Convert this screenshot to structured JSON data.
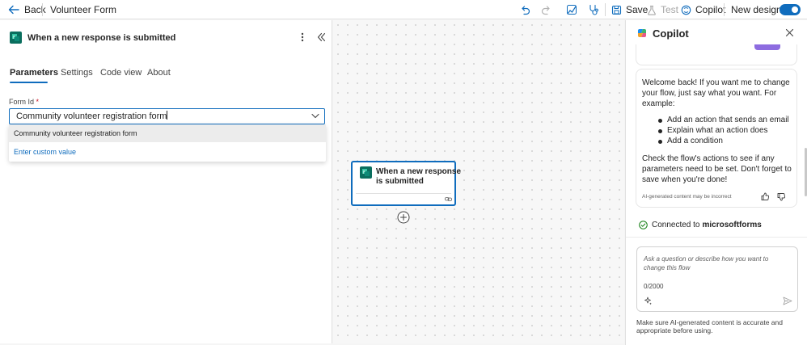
{
  "topbar": {
    "back_label": "Back",
    "flow_name": "Volunteer Form",
    "save_label": "Save",
    "test_label": "Test",
    "copilot_label": "Copilot",
    "new_designer_label": "New designer",
    "new_designer_on": true
  },
  "left_panel": {
    "title": "When a new response is submitted",
    "tabs": [
      {
        "label": "Parameters",
        "active": true
      },
      {
        "label": "Settings",
        "active": false
      },
      {
        "label": "Code view",
        "active": false
      },
      {
        "label": "About",
        "active": false
      }
    ],
    "form_id": {
      "label": "Form Id",
      "required_mark": "*",
      "value": "Community volunteer registration form",
      "options": [
        "Community volunteer registration form"
      ],
      "custom_value_label": "Enter custom value"
    }
  },
  "canvas": {
    "trigger_card": {
      "line1": "When a new response",
      "line2": "is submitted"
    }
  },
  "copilot": {
    "title": "Copilot",
    "message": {
      "lines": [
        "Welcome back! If you want me to change",
        "your flow, just say what you want. For",
        "example:"
      ],
      "bullets": [
        "Add an action that sends an email",
        "Explain what an action does",
        "Add a condition"
      ],
      "closing": [
        "Check the flow's actions to see if any",
        "parameters need to be set. Don't forget to",
        "save when you're done!"
      ],
      "disclaimer": "AI-generated content may be incorrect"
    },
    "connected_prefix": "Connected to",
    "connected_service": "microsoftforms",
    "input": {
      "placeholder_line1": "Ask a question or describe how you want to",
      "placeholder_line2": "change this flow",
      "char_count": "0/2000"
    },
    "footer_line1": "Make sure AI-generated content is accurate and",
    "footer_line2": "appropriate before using."
  },
  "colors": {
    "accent": "#0f6cbd",
    "trigger_icon": "#0a6e5e",
    "success": "#107c10"
  }
}
